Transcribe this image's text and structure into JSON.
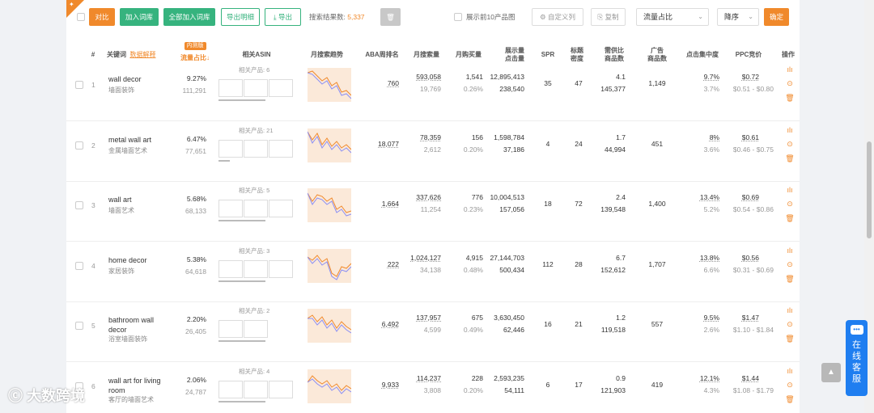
{
  "toolbar": {
    "compare": "对比",
    "add_to_lib": "加入词库",
    "add_all_to_lib": "全部加入词库",
    "export_detail": "导出明细",
    "export": "导出",
    "result_label": "搜索结果数:",
    "result_count": "5,337",
    "show_top10": "展示前10产品图",
    "custom_columns": "自定义列",
    "copy": "复制",
    "sort_field": "流量占比",
    "sort_order": "降序",
    "confirm": "确定"
  },
  "header": {
    "index": "#",
    "keyword": "关键词",
    "keyword_sub": "数据解释",
    "traffic_badge": "内测版",
    "traffic": "流量占比↓",
    "related_asin": "相关ASIN",
    "trend": "月搜索趋势",
    "aba_rank": "ABA周排名",
    "monthly_search": "月搜索量",
    "monthly_purchase": "月购买量",
    "impressions_1": "展示量",
    "impressions_2": "点击量",
    "spr": "SPR",
    "title_density_1": "标题",
    "title_density_2": "密度",
    "supply_ratio_1": "需供比",
    "supply_ratio_2": "商品数",
    "ad_products_1": "广告",
    "ad_products_2": "商品数",
    "click_concentration": "点击集中度",
    "ppc": "PPC竞价",
    "actions": "操作"
  },
  "rows": [
    {
      "idx": "1",
      "kw": "wall decor",
      "cn": "墙面装饰",
      "share": "9.27%",
      "share_sub": "111,291",
      "rel": "相关产品: 6",
      "aba": "760",
      "search": "593,058",
      "search_sub": "19,769",
      "purchase": "1,541",
      "purchase_rate": "0.26%",
      "impr": "12,895,413",
      "clicks": "238,540",
      "spr": "35",
      "density": "47",
      "ratio": "4.1",
      "products": "145,377",
      "ads": "1,149",
      "conc": "9.7%",
      "conc_sub": "3.7%",
      "ppc": "$0.72",
      "ppc_range": "$0.51 - $0.80"
    },
    {
      "idx": "2",
      "kw": "metal wall art",
      "cn": "金属墙面艺术",
      "share": "6.47%",
      "share_sub": "77,651",
      "rel": "相关产品: 21",
      "aba": "18,077",
      "search": "78,359",
      "search_sub": "2,612",
      "purchase": "156",
      "purchase_rate": "0.20%",
      "impr": "1,598,784",
      "clicks": "37,186",
      "spr": "4",
      "density": "24",
      "ratio": "1.7",
      "products": "44,994",
      "ads": "451",
      "conc": "8%",
      "conc_sub": "3.6%",
      "ppc": "$0.61",
      "ppc_range": "$0.46 - $0.75"
    },
    {
      "idx": "3",
      "kw": "wall art",
      "cn": "墙面艺术",
      "share": "5.68%",
      "share_sub": "68,133",
      "rel": "相关产品: 5",
      "aba": "1,664",
      "search": "337,626",
      "search_sub": "11,254",
      "purchase": "776",
      "purchase_rate": "0.23%",
      "impr": "10,004,513",
      "clicks": "157,056",
      "spr": "18",
      "density": "72",
      "ratio": "2.4",
      "products": "139,548",
      "ads": "1,400",
      "conc": "13.4%",
      "conc_sub": "5.2%",
      "ppc": "$0.69",
      "ppc_range": "$0.54 - $0.86"
    },
    {
      "idx": "4",
      "kw": "home decor",
      "cn": "家居装饰",
      "share": "5.38%",
      "share_sub": "64,618",
      "rel": "相关产品: 3",
      "aba": "222",
      "search": "1,024,127",
      "search_sub": "34,138",
      "purchase": "4,915",
      "purchase_rate": "0.48%",
      "impr": "27,144,703",
      "clicks": "500,434",
      "spr": "112",
      "density": "28",
      "ratio": "6.7",
      "products": "152,612",
      "ads": "1,707",
      "conc": "13.8%",
      "conc_sub": "6.6%",
      "ppc": "$0.56",
      "ppc_range": "$0.31 - $0.69"
    },
    {
      "idx": "5",
      "kw": "bathroom wall decor",
      "cn": "浴室墙面装饰",
      "share": "2.20%",
      "share_sub": "26,405",
      "rel": "相关产品: 2",
      "aba": "6,492",
      "search": "137,957",
      "search_sub": "4,599",
      "purchase": "675",
      "purchase_rate": "0.49%",
      "impr": "3,630,450",
      "clicks": "62,446",
      "spr": "16",
      "density": "21",
      "ratio": "1.2",
      "products": "119,518",
      "ads": "557",
      "conc": "9.5%",
      "conc_sub": "2.6%",
      "ppc": "$1.47",
      "ppc_range": "$1.10 - $1.84"
    },
    {
      "idx": "6",
      "kw": "wall art for living room",
      "cn": "客厅的墙面艺术",
      "share": "2.06%",
      "share_sub": "24,787",
      "rel": "相关产品: 4",
      "aba": "9,933",
      "search": "114,237",
      "search_sub": "3,808",
      "purchase": "228",
      "purchase_rate": "0.20%",
      "impr": "2,593,235",
      "clicks": "54,111",
      "spr": "6",
      "density": "17",
      "ratio": "0.9",
      "products": "121,903",
      "ads": "419",
      "conc": "12.1%",
      "conc_sub": "4.3%",
      "ppc": "$1.44",
      "ppc_range": "$1.08 - $1.79"
    }
  ],
  "service": {
    "label": "在线客服"
  },
  "watermark": "大数跨境",
  "colors": {
    "accent": "#f0892b",
    "green": "#36b37e",
    "service": "#1f7ef0"
  }
}
